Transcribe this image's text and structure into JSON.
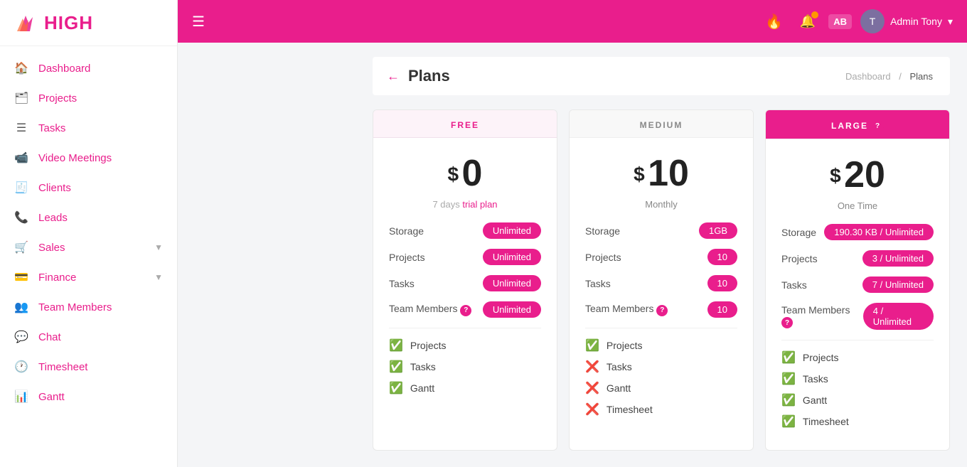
{
  "app": {
    "logo_text": "HIGH"
  },
  "topbar": {
    "hamburger_label": "☰",
    "user_name": "Admin Tony",
    "user_dropdown": "▾",
    "ab_label": "AB"
  },
  "sidebar": {
    "items": [
      {
        "id": "dashboard",
        "label": "Dashboard",
        "icon": "🏠"
      },
      {
        "id": "projects",
        "label": "Projects",
        "icon": "🗂"
      },
      {
        "id": "tasks",
        "label": "Tasks",
        "icon": "☰"
      },
      {
        "id": "video-meetings",
        "label": "Video Meetings",
        "icon": "📹"
      },
      {
        "id": "clients",
        "label": "Clients",
        "icon": "🧾"
      },
      {
        "id": "leads",
        "label": "Leads",
        "icon": "📞"
      },
      {
        "id": "sales",
        "label": "Sales",
        "icon": "🛒",
        "has_arrow": true
      },
      {
        "id": "finance",
        "label": "Finance",
        "icon": "💳",
        "has_arrow": true
      },
      {
        "id": "team-members",
        "label": "Team Members",
        "icon": "👥"
      },
      {
        "id": "chat",
        "label": "Chat",
        "icon": "💬"
      },
      {
        "id": "timesheet",
        "label": "Timesheet",
        "icon": "🕐"
      },
      {
        "id": "gantt",
        "label": "Gantt",
        "icon": "📊"
      }
    ]
  },
  "page": {
    "title": "Plans",
    "back_icon": "←",
    "breadcrumb_home": "Dashboard",
    "breadcrumb_sep": "/",
    "breadcrumb_current": "Plans"
  },
  "plans": [
    {
      "id": "free",
      "header": "FREE",
      "header_type": "free",
      "price": "0",
      "currency": "$",
      "period": "",
      "trial_text": "7 days trial plan",
      "trial_link": "trial plan",
      "features": [
        {
          "label": "Storage",
          "value": "Unlimited"
        },
        {
          "label": "Projects",
          "value": "Unlimited"
        },
        {
          "label": "Tasks",
          "value": "Unlimited"
        },
        {
          "label": "Team Members",
          "value": "Unlimited",
          "has_help": true
        }
      ],
      "items": [
        {
          "label": "Projects",
          "status": "check"
        },
        {
          "label": "Tasks",
          "status": "check"
        },
        {
          "label": "Gantt",
          "status": "check"
        }
      ]
    },
    {
      "id": "medium",
      "header": "MEDIUM",
      "header_type": "medium",
      "price": "10",
      "currency": "$",
      "period": "Monthly",
      "trial_text": "",
      "features": [
        {
          "label": "Storage",
          "value": "1GB"
        },
        {
          "label": "Projects",
          "value": "10"
        },
        {
          "label": "Tasks",
          "value": "10"
        },
        {
          "label": "Team Members",
          "value": "10",
          "has_help": true
        }
      ],
      "items": [
        {
          "label": "Projects",
          "status": "check"
        },
        {
          "label": "Tasks",
          "status": "cross"
        },
        {
          "label": "Gantt",
          "status": "cross"
        },
        {
          "label": "Timesheet",
          "status": "cross"
        }
      ]
    },
    {
      "id": "large",
      "header": "LARGE",
      "header_type": "large",
      "price": "20",
      "currency": "$",
      "period": "One Time",
      "trial_text": "",
      "features": [
        {
          "label": "Storage",
          "value": "190.30 KB / Unlimited"
        },
        {
          "label": "Projects",
          "value": "3 / Unlimited"
        },
        {
          "label": "Tasks",
          "value": "7 / Unlimited"
        },
        {
          "label": "Team Members",
          "value": "4 / Unlimited",
          "has_help": true
        }
      ],
      "items": [
        {
          "label": "Projects",
          "status": "check"
        },
        {
          "label": "Tasks",
          "status": "check"
        },
        {
          "label": "Gantt",
          "status": "check"
        },
        {
          "label": "Timesheet",
          "status": "check"
        }
      ]
    }
  ]
}
